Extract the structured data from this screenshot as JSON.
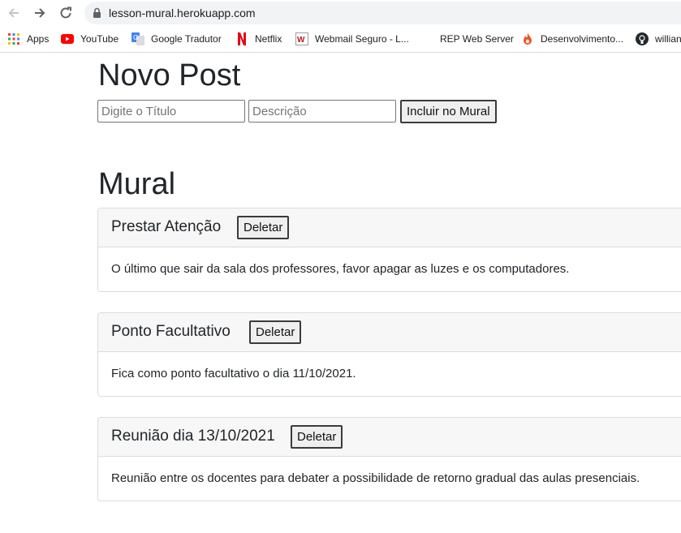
{
  "browser": {
    "url": "lesson-mural.herokuapp.com",
    "bookmarks": [
      {
        "label": "Apps",
        "icon": "apps-grid-icon"
      },
      {
        "label": "YouTube",
        "icon": "youtube-icon"
      },
      {
        "label": "Google Tradutor",
        "icon": "google-translate-icon"
      },
      {
        "label": "Netflix",
        "icon": "netflix-icon"
      },
      {
        "label": "Webmail Seguro - L...",
        "icon": "webmail-icon"
      },
      {
        "label": "REP Web Server",
        "icon": "blank-page-icon"
      },
      {
        "label": "Desenvolvimento...",
        "icon": "flame-icon"
      },
      {
        "label": "willian",
        "icon": "github-icon"
      }
    ]
  },
  "new_post": {
    "heading": "Novo Post",
    "title_placeholder": "Digite o Título",
    "description_placeholder": "Descrição",
    "submit_label": "Incluir no Mural"
  },
  "mural": {
    "heading": "Mural",
    "delete_label": "Deletar",
    "posts": [
      {
        "title": "Prestar Atenção",
        "body": "O último que sair da sala dos professores, favor apagar as luzes e os computadores."
      },
      {
        "title": "Ponto Facultativo",
        "body": "Fica como ponto facultativo o dia 11/10/2021."
      },
      {
        "title": "Reunião dia 13/10/2021",
        "body": "Reunião entre os docentes para debater a possibilidade de retorno gradual das aulas presenciais."
      }
    ]
  }
}
